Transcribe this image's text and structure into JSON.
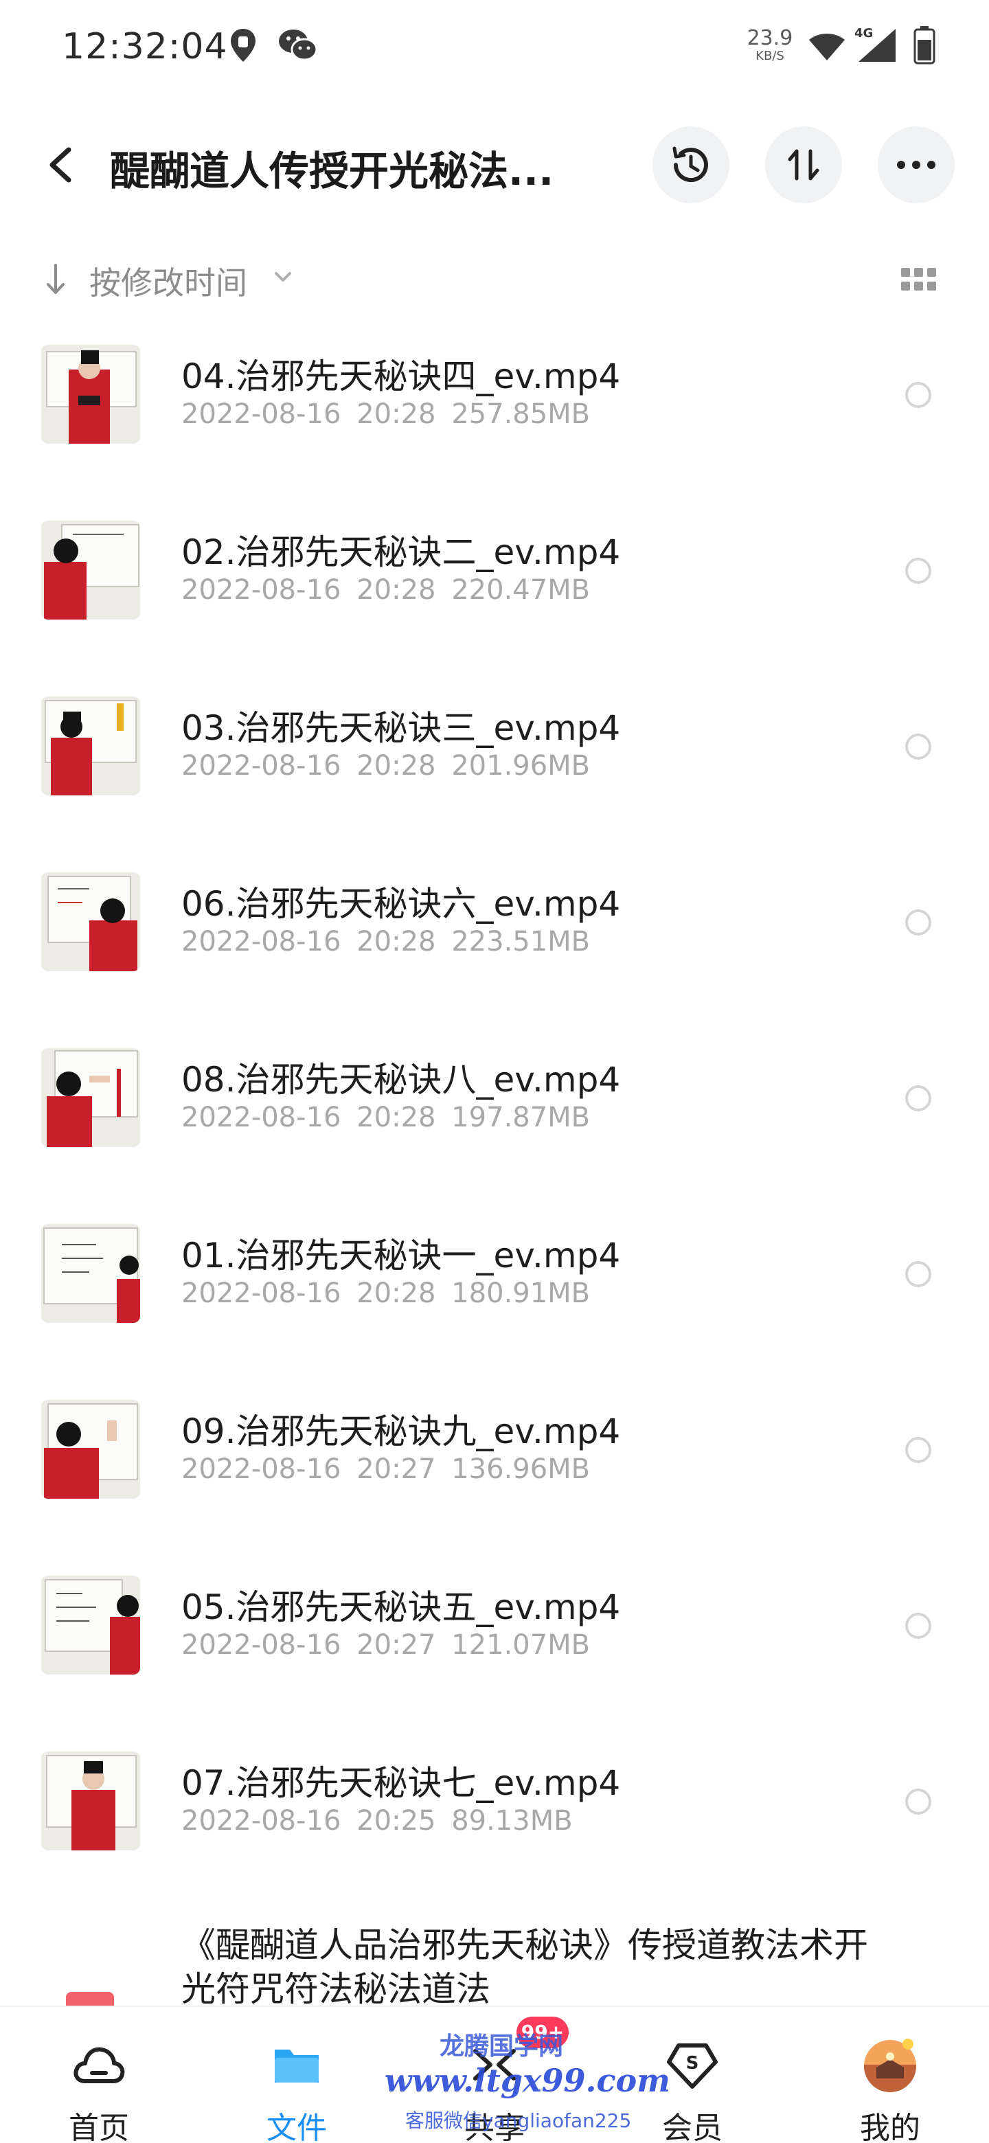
{
  "status_bar": {
    "time": "12:32:04",
    "network_speed_value": "23.9",
    "network_speed_unit": "KB/S",
    "network_type": "4G"
  },
  "header": {
    "title": "醍醐道人传授开光秘法..."
  },
  "sort": {
    "label": "按修改时间"
  },
  "files": [
    {
      "name": "04.治邪先天秘诀四_ev.mp4",
      "date": "2022-08-16",
      "time": "20:28",
      "size": "257.85MB"
    },
    {
      "name": "02.治邪先天秘诀二_ev.mp4",
      "date": "2022-08-16",
      "time": "20:28",
      "size": "220.47MB"
    },
    {
      "name": "03.治邪先天秘诀三_ev.mp4",
      "date": "2022-08-16",
      "time": "20:28",
      "size": "201.96MB"
    },
    {
      "name": "06.治邪先天秘诀六_ev.mp4",
      "date": "2022-08-16",
      "time": "20:28",
      "size": "223.51MB"
    },
    {
      "name": "08.治邪先天秘诀八_ev.mp4",
      "date": "2022-08-16",
      "time": "20:28",
      "size": "197.87MB"
    },
    {
      "name": "01.治邪先天秘诀一_ev.mp4",
      "date": "2022-08-16",
      "time": "20:28",
      "size": "180.91MB"
    },
    {
      "name": "09.治邪先天秘诀九_ev.mp4",
      "date": "2022-08-16",
      "time": "20:27",
      "size": "136.96MB"
    },
    {
      "name": "05.治邪先天秘诀五_ev.mp4",
      "date": "2022-08-16",
      "time": "20:27",
      "size": "121.07MB"
    },
    {
      "name": "07.治邪先天秘诀七_ev.mp4",
      "date": "2022-08-16",
      "time": "20:25",
      "size": "89.13MB"
    }
  ],
  "doc_item": {
    "name": "《醍醐道人品治邪先天秘诀》传授道教法术开光符咒符法秘法道法"
  },
  "bottom_nav": {
    "items": [
      {
        "label": "首页",
        "icon": "cloud-icon"
      },
      {
        "label": "文件",
        "icon": "folder-icon",
        "active": true
      },
      {
        "label": "共享",
        "icon": "share-icon"
      },
      {
        "label": "会员",
        "icon": "vip-diamond-icon"
      },
      {
        "label": "我的",
        "icon": "avatar"
      }
    ],
    "badge": "99+"
  },
  "watermark": {
    "line1": "龙腾国学网",
    "line2": "www.ltgx99.com",
    "line3": "客服微信yangliaofan225"
  },
  "colors": {
    "accent": "#1a8ff5",
    "badge": "#ff3b5c",
    "secondary_text": "#a8a8a8"
  }
}
